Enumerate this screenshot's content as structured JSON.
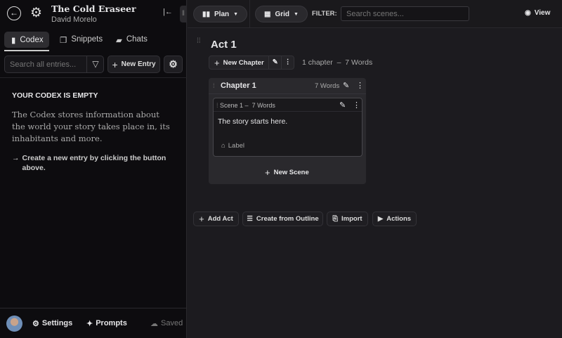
{
  "project": {
    "title": "The Cold Eraseer",
    "author": "David Morelo"
  },
  "sidebar": {
    "tabs": [
      {
        "label": "Codex"
      },
      {
        "label": "Snippets"
      },
      {
        "label": "Chats"
      }
    ],
    "search_placeholder": "Search all entries...",
    "new_entry_label": "New Entry",
    "empty_title": "YOUR CODEX IS EMPTY",
    "empty_desc": "The Codex stores information about the world your story takes place in, its inhabitants and more.",
    "empty_hint": "Create a new entry by clicking the button above.",
    "footer": {
      "settings": "Settings",
      "prompts": "Prompts",
      "saved": "Saved"
    }
  },
  "toolbar": {
    "plan": "Plan",
    "grid": "Grid",
    "filter_label": "FILTER:",
    "search_placeholder": "Search scenes...",
    "view": "View"
  },
  "act": {
    "title": "Act 1",
    "new_chapter": "New Chapter",
    "summary": "1 chapter  –  7 Words",
    "chapter": {
      "title": "Chapter 1",
      "words": "7 Words",
      "scene": {
        "title": "Scene 1 –  7 Words",
        "text": "The story starts here.",
        "label": "Label"
      },
      "new_scene": "New Scene"
    }
  },
  "actions": {
    "add_act": "Add Act",
    "create_outline": "Create from Outline",
    "import": "Import",
    "actions": "Actions"
  }
}
